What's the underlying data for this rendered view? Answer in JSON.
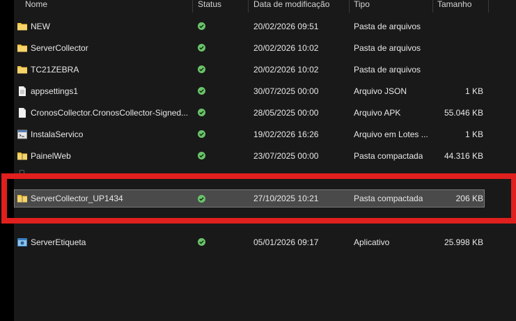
{
  "columns": {
    "name": "Nome",
    "status": "Status",
    "modified": "Data de modificação",
    "type": "Tipo",
    "size": "Tamanho"
  },
  "rows": [
    {
      "name": "NEW",
      "modified": "20/02/2026 09:51",
      "type": "Pasta de arquivos",
      "size": "",
      "icon": "folder-icon"
    },
    {
      "name": "ServerCollector",
      "modified": "20/02/2026 10:02",
      "type": "Pasta de arquivos",
      "size": "",
      "icon": "folder-icon"
    },
    {
      "name": "TC21ZEBRA",
      "modified": "20/02/2026 10:02",
      "type": "Pasta de arquivos",
      "size": "",
      "icon": "folder-icon"
    },
    {
      "name": "appsettings1",
      "modified": "30/07/2025 00:00",
      "type": "Arquivo JSON",
      "size": "1 KB",
      "icon": "document-icon"
    },
    {
      "name": "CronosCollector.CronosCollector-Signed...",
      "modified": "28/05/2025 00:00",
      "type": "Arquivo APK",
      "size": "55.046 KB",
      "icon": "document-icon"
    },
    {
      "name": "InstalaServico",
      "modified": "19/02/2026 16:26",
      "type": "Arquivo em Lotes ...",
      "size": "1 KB",
      "icon": "batch-file-icon"
    },
    {
      "name": "PainelWeb",
      "modified": "23/07/2025 00:00",
      "type": "Pasta compactada",
      "size": "44.316 KB",
      "icon": "zip-folder-icon"
    },
    {
      "name": "ServerCollector_UP1434",
      "modified": "27/10/2025 10:21",
      "type": "Pasta compactada",
      "size": "206 KB",
      "icon": "zip-folder-icon"
    },
    {
      "name": "ServerEtiqueta",
      "modified": "05/01/2026 09:17",
      "type": "Aplicativo",
      "size": "25.998 KB",
      "icon": "application-icon"
    }
  ],
  "selected_index": 7,
  "colors": {
    "highlight_box": "#e0201e",
    "status_ok": "#6ac36a",
    "folder": "#f0c33c"
  }
}
